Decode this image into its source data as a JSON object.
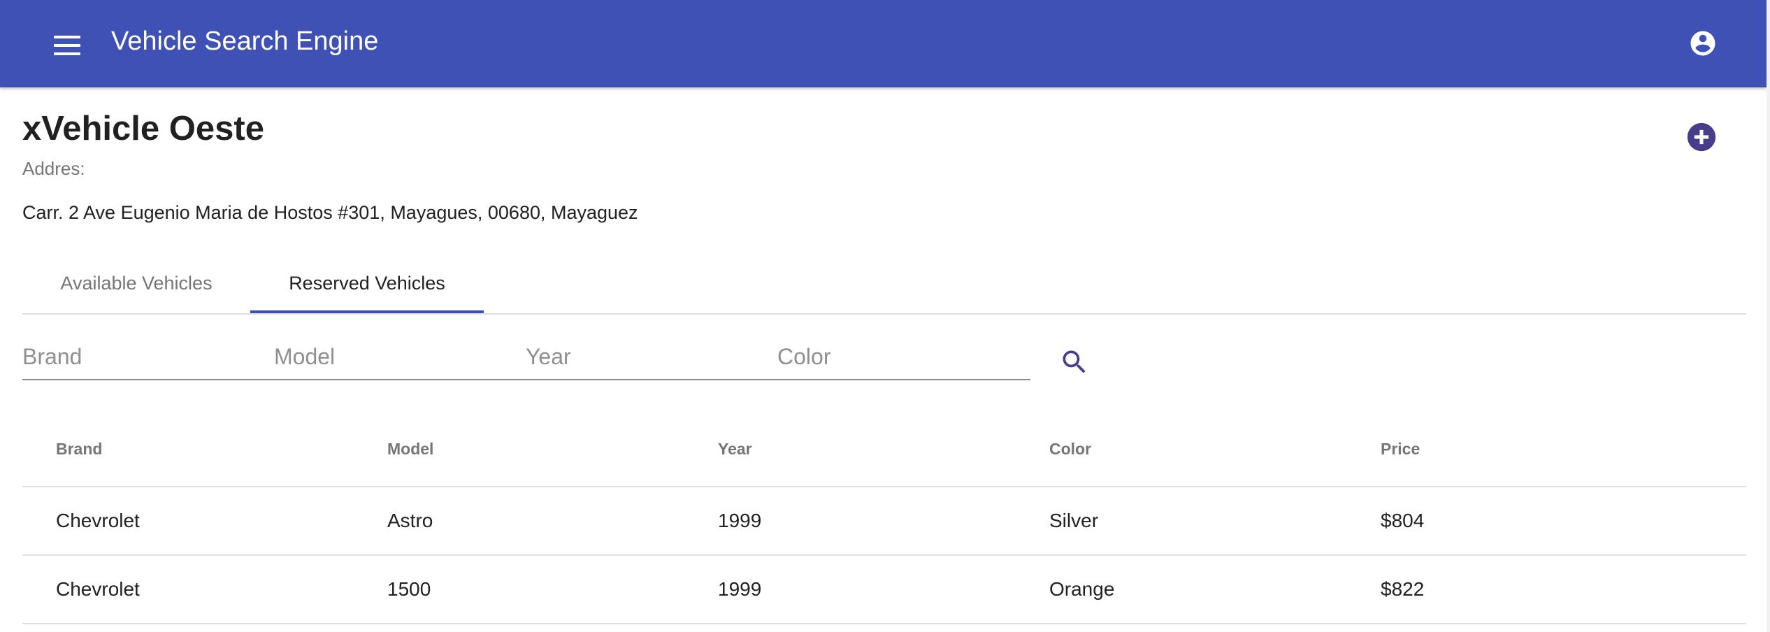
{
  "toolbar": {
    "title": "Vehicle Search Engine",
    "menu_icon": "menu-icon",
    "account_icon": "account-circle-icon",
    "color": "#3f51b5"
  },
  "dealer": {
    "name": "xVehicle Oeste",
    "address_label": "Addres:",
    "address": "Carr. 2 Ave Eugenio Maria de Hostos #301, Mayagues, 00680, Mayaguez",
    "add_icon": "add-circle-icon"
  },
  "tabs": [
    {
      "label": "Available Vehicles",
      "selected": false
    },
    {
      "label": "Reserved Vehicles",
      "selected": true
    }
  ],
  "filters": {
    "brand_placeholder": "Brand",
    "model_placeholder": "Model",
    "year_placeholder": "Year",
    "color_placeholder": "Color",
    "search_icon": "search-icon"
  },
  "table": {
    "headers": [
      "Brand",
      "Model",
      "Year",
      "Color",
      "Price"
    ],
    "rows": [
      [
        "Chevrolet",
        "Astro",
        "1999",
        "Silver",
        "$804"
      ],
      [
        "Chevrolet",
        "1500",
        "1999",
        "Orange",
        "$822"
      ]
    ]
  },
  "colors": {
    "primary": "#3f51b5",
    "accent": "#483d8b"
  }
}
